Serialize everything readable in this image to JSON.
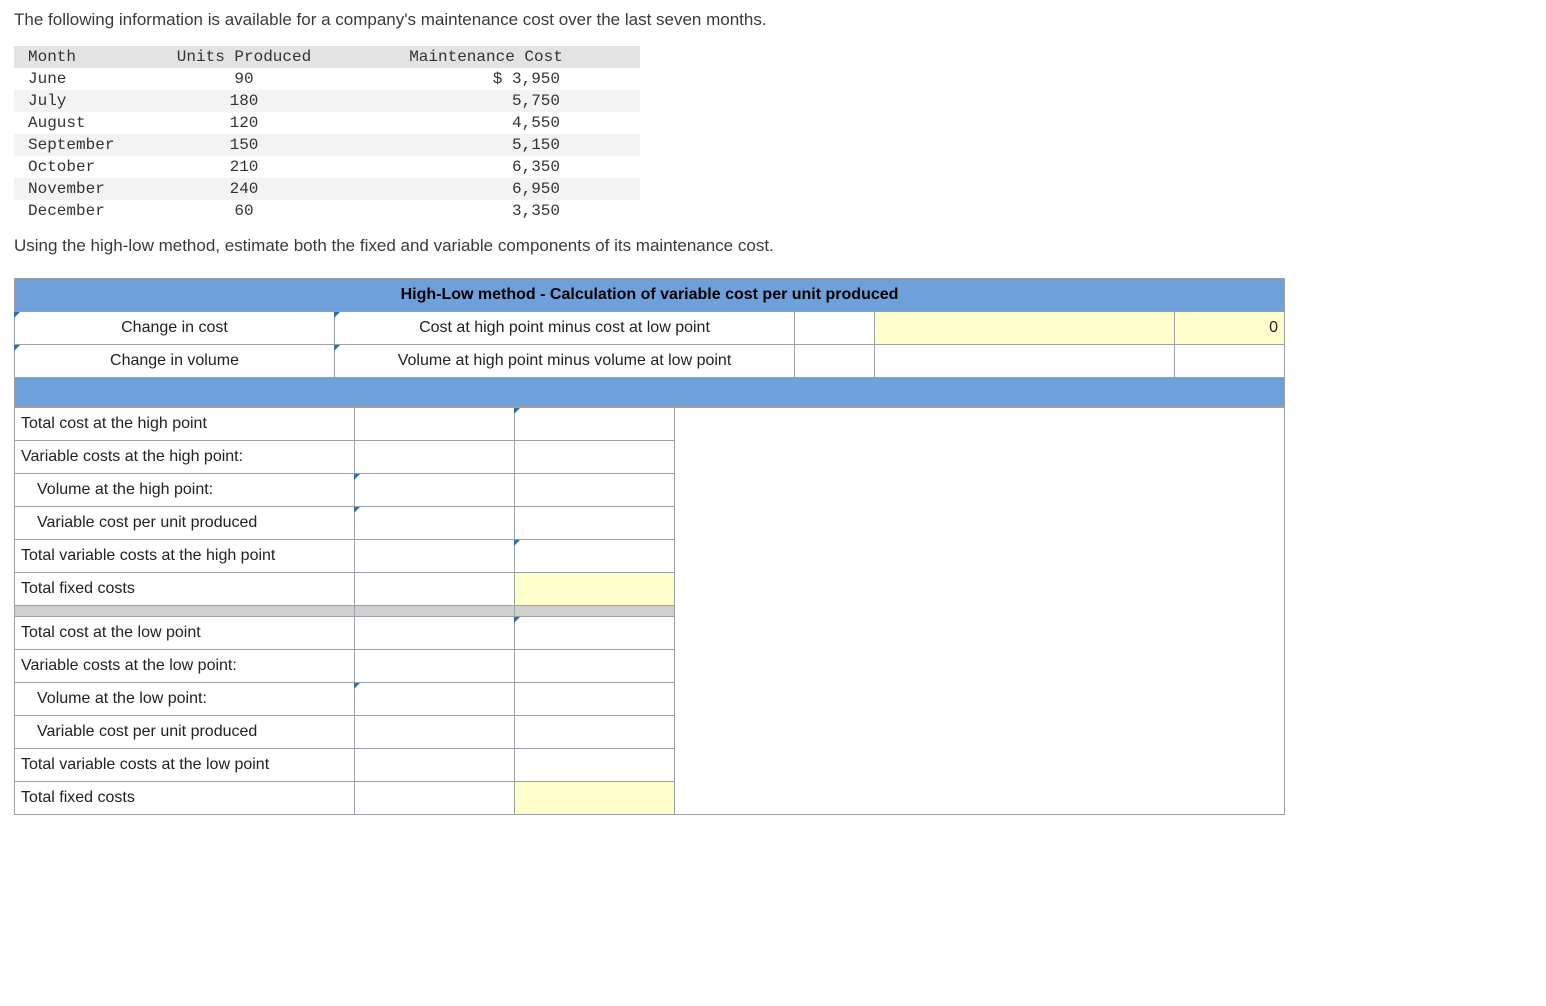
{
  "intro": "The following information is available for a company's maintenance cost over the last seven months.",
  "data_table": {
    "headers": {
      "month": "Month",
      "units": "Units Produced",
      "cost": "Maintenance Cost"
    },
    "rows": [
      {
        "month": "June",
        "units": "90",
        "cost": "$ 3,950"
      },
      {
        "month": "July",
        "units": "180",
        "cost": "5,750"
      },
      {
        "month": "August",
        "units": "120",
        "cost": "4,550"
      },
      {
        "month": "September",
        "units": "150",
        "cost": "5,150"
      },
      {
        "month": "October",
        "units": "210",
        "cost": "6,350"
      },
      {
        "month": "November",
        "units": "240",
        "cost": "6,950"
      },
      {
        "month": "December",
        "units": "60",
        "cost": "3,350"
      }
    ]
  },
  "instruction": "Using the high-low method, estimate both the fixed and variable components of its maintenance cost.",
  "ws1": {
    "title": "High-Low method - Calculation of variable cost per unit produced",
    "row1": {
      "label": "Change in cost",
      "desc": "Cost at high point minus cost at low point",
      "val_a": "",
      "val_b": "",
      "result": "0"
    },
    "row2": {
      "label": "Change in volume",
      "desc": "Volume at high point minus volume at low point",
      "val_a": "",
      "val_b": "",
      "result": ""
    }
  },
  "ws2": {
    "high": {
      "total_cost": "Total cost at the high point",
      "var_costs_header": "Variable costs at the high point:",
      "volume": "Volume at the high point:",
      "vcpu": "Variable cost per unit produced",
      "total_var": "Total variable costs at the high point",
      "fixed": "Total fixed costs"
    },
    "low": {
      "total_cost": "Total cost at the low point",
      "var_costs_header": "Variable costs at the low point:",
      "volume": "Volume at the low point:",
      "vcpu": "Variable cost per unit produced",
      "total_var": "Total variable costs at the low point",
      "fixed": "Total fixed costs"
    }
  }
}
